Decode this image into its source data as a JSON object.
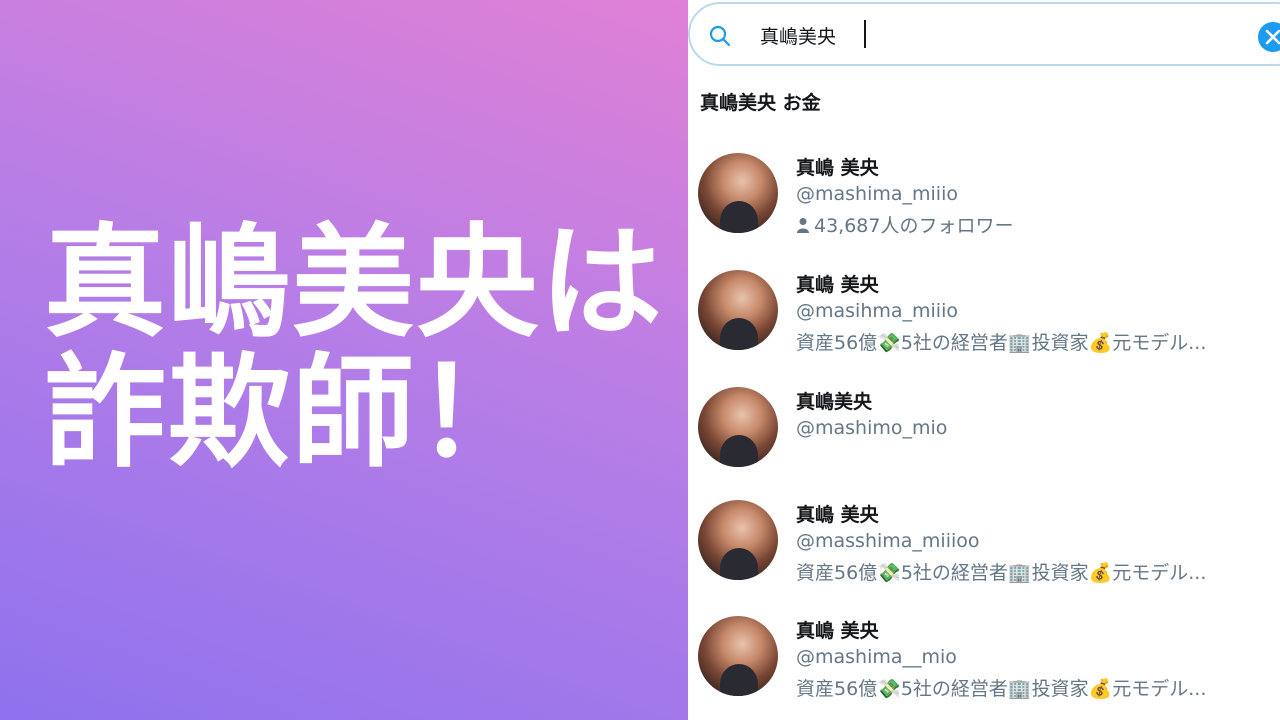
{
  "headline": {
    "line1": "真嶋美央は",
    "line2": "詐欺師！"
  },
  "search": {
    "query": "真嶋美央",
    "suggestion": "真嶋美央 お金"
  },
  "results": [
    {
      "name": "真嶋 美央",
      "handle": "@mashima_miiio",
      "followers": "43,687人のフォロワー"
    },
    {
      "name": "真嶋 美央",
      "handle": "@masihma_miiio",
      "bio": "資産56億💸5社の経営者🏢投資家💰元モデル..."
    },
    {
      "name": "真嶋美央",
      "handle": "@mashimo_mio"
    },
    {
      "name": "真嶋 美央",
      "handle": "@masshima_miiioo",
      "bio": "資産56億💸5社の経営者🏢投資家💰元モデル..."
    },
    {
      "name": "真嶋 美央",
      "handle": "@mashima__mio",
      "bio": "資産56億💸5社の経営者🏢投資家💰元モデル..."
    }
  ],
  "colors": {
    "accent": "#1d9bf0",
    "gradient_top": "#e080d6",
    "gradient_bottom": "#8f72ee"
  }
}
